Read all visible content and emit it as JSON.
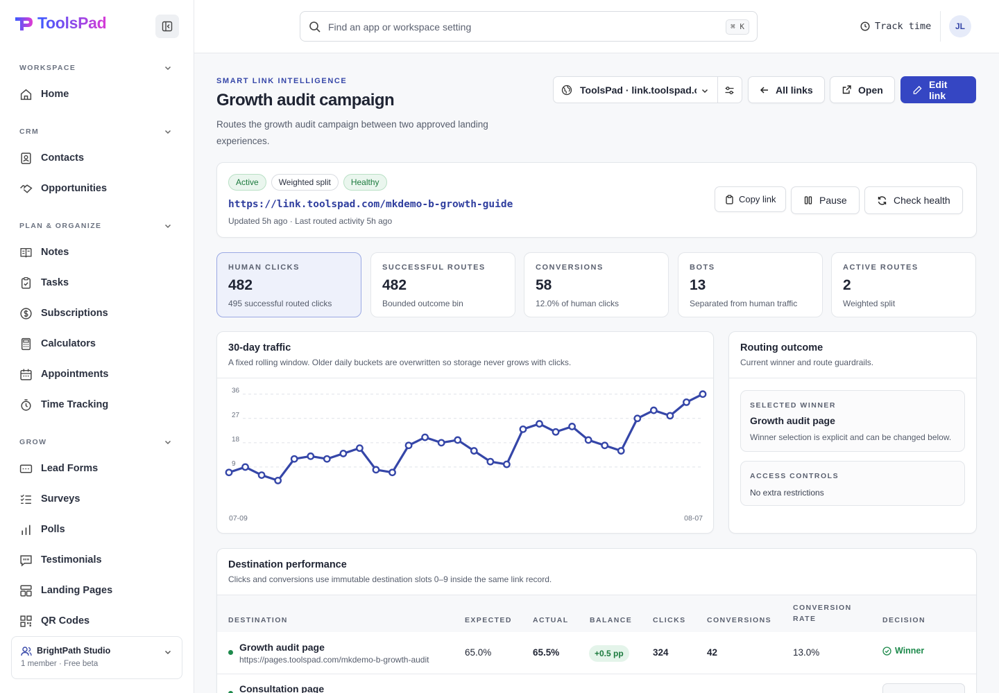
{
  "brand": {
    "name": "ToolsPad",
    "accent": "#3546c3"
  },
  "sidebar": {
    "sections": [
      {
        "title": "WORKSPACE",
        "items": [
          {
            "label": "Home",
            "icon": "home-icon"
          }
        ]
      },
      {
        "title": "CRM",
        "items": [
          {
            "label": "Contacts",
            "icon": "contacts-icon"
          },
          {
            "label": "Opportunities",
            "icon": "handshake-icon"
          }
        ]
      },
      {
        "title": "PLAN & ORGANIZE",
        "items": [
          {
            "label": "Notes",
            "icon": "notes-icon"
          },
          {
            "label": "Tasks",
            "icon": "clipboard-check-icon"
          },
          {
            "label": "Subscriptions",
            "icon": "dollar-circle-icon"
          },
          {
            "label": "Calculators",
            "icon": "calculator-icon"
          },
          {
            "label": "Appointments",
            "icon": "calendar-icon"
          },
          {
            "label": "Time Tracking",
            "icon": "stopwatch-icon"
          }
        ]
      },
      {
        "title": "GROW",
        "items": [
          {
            "label": "Lead Forms",
            "icon": "form-icon"
          },
          {
            "label": "Surveys",
            "icon": "survey-list-icon"
          },
          {
            "label": "Polls",
            "icon": "bar-chart-icon"
          },
          {
            "label": "Testimonials",
            "icon": "quote-bubble-icon"
          },
          {
            "label": "Landing Pages",
            "icon": "layout-icon"
          },
          {
            "label": "QR Codes",
            "icon": "qr-code-icon"
          }
        ]
      }
    ],
    "workspace": {
      "name": "BrightPath Studio",
      "meta": "1 member · Free beta"
    }
  },
  "topbar": {
    "search_placeholder": "Find an app or workspace setting",
    "shortcut": "⌘ K",
    "track_time": "Track time",
    "avatar_initials": "JL"
  },
  "header": {
    "eyebrow": "SMART LINK INTELLIGENCE",
    "title": "Growth audit campaign",
    "description": "Routes the growth audit campaign between two approved landing experiences.",
    "domain_select": "ToolsPad · link.toolspad.c",
    "all_links": "All links",
    "open": "Open",
    "edit_link": "Edit link"
  },
  "link": {
    "badges": [
      {
        "label": "Active",
        "tone": "green"
      },
      {
        "label": "Weighted split",
        "tone": "neutral"
      },
      {
        "label": "Healthy",
        "tone": "green"
      }
    ],
    "url": "https://link.toolspad.com/mkdemo-b-growth-guide",
    "updated": "Updated 5h ago · Last routed activity 5h ago",
    "copy_link": "Copy link",
    "pause": "Pause",
    "check_health": "Check health"
  },
  "stats": [
    {
      "label": "HUMAN CLICKS",
      "value": "482",
      "sub": "495 successful routed clicks",
      "selected": true
    },
    {
      "label": "SUCCESSFUL ROUTES",
      "value": "482",
      "sub": "Bounded outcome bin",
      "selected": false
    },
    {
      "label": "CONVERSIONS",
      "value": "58",
      "sub": "12.0% of human clicks",
      "selected": false
    },
    {
      "label": "BOTS",
      "value": "13",
      "sub": "Separated from human traffic",
      "selected": false
    },
    {
      "label": "ACTIVE ROUTES",
      "value": "2",
      "sub": "Weighted split",
      "selected": false
    }
  ],
  "traffic": {
    "title": "30-day traffic",
    "subtitle": "A fixed rolling window. Older daily buckets are overwritten so storage never grows with clicks."
  },
  "chart_data": {
    "type": "line",
    "x_start": "07-09",
    "x_end": "08-07",
    "yticks": [
      36,
      27,
      18,
      9
    ],
    "ylim": [
      0,
      39
    ],
    "color": "#3546a8",
    "values": [
      7,
      9,
      6,
      4,
      12,
      13,
      12,
      14,
      16,
      8,
      7,
      17,
      20,
      18,
      19,
      15,
      11,
      10,
      23,
      25,
      22,
      24,
      19,
      17,
      15,
      27,
      30,
      28,
      33,
      36
    ]
  },
  "routing": {
    "title": "Routing outcome",
    "subtitle": "Current winner and route guardrails.",
    "winner_label": "SELECTED WINNER",
    "winner_name": "Growth audit page",
    "winner_note": "Winner selection is explicit and can be changed below.",
    "access_label": "ACCESS CONTROLS",
    "access_value": "No extra restrictions"
  },
  "destinations": {
    "title": "Destination performance",
    "subtitle": "Clicks and conversions use immutable destination slots 0–9 inside the same link record.",
    "columns": [
      "DESTINATION",
      "EXPECTED",
      "ACTUAL",
      "BALANCE",
      "CLICKS",
      "CONVERSIONS",
      "CONVERSION RATE",
      "DECISION"
    ],
    "rows": [
      {
        "name": "Growth audit page",
        "url": "https://pages.toolspad.com/mkdemo-b-growth-audit",
        "expected": "65.0%",
        "actual": "65.5%",
        "balance": "+0.5 pp",
        "clicks": "324",
        "conversions": "42",
        "rate": "13.0%",
        "decision": "Winner"
      },
      {
        "name": "Consultation page",
        "url": "",
        "expected": "",
        "actual": "",
        "balance": "",
        "clicks": "",
        "conversions": "",
        "rate": "",
        "decision": ""
      }
    ]
  }
}
